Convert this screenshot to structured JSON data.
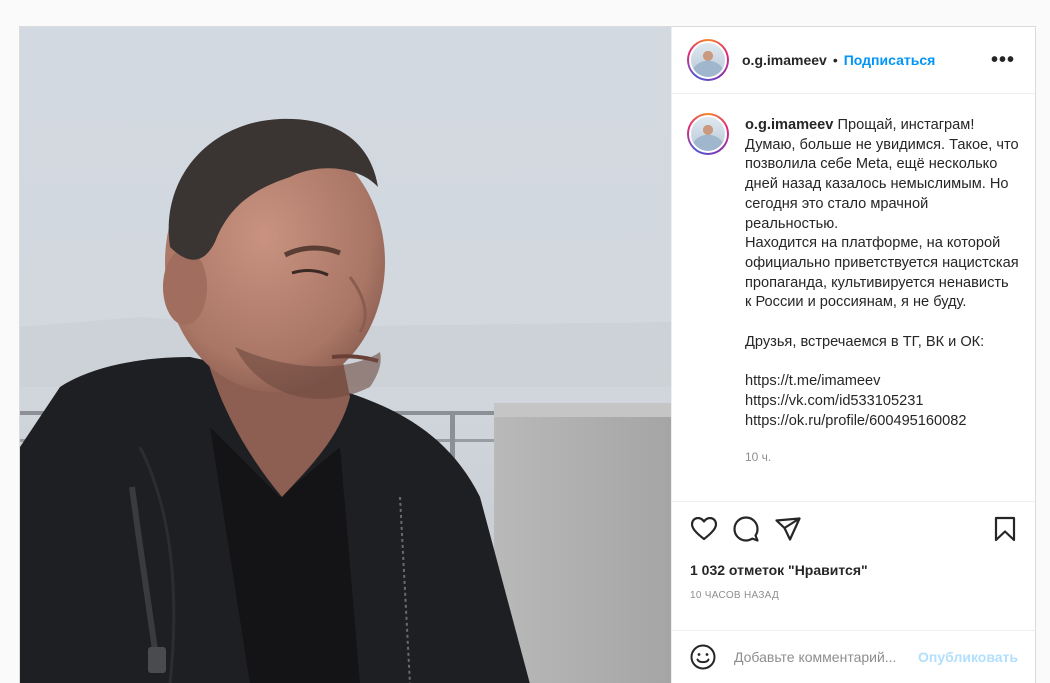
{
  "post": {
    "image_alt": "Man in black jacket looking into the distance by the waterfront",
    "author": {
      "username": "o.g.imameev"
    },
    "header": {
      "dot": "•",
      "follow_label": "Подписаться",
      "more_label": "•••"
    },
    "caption": {
      "username": "o.g.imameev",
      "text": "Прощай, инстаграм! Думаю, больше не увидимся. Такое, что позволила себе Meta, ещё несколько дней назад казалось немыслимым. Но сегодня это стало мрачной реальностью.\nНаходится на платформе, на которой официально приветствуется нацистская пропаганда, культивируется ненависть к России и россиянам, я не буду.\n\nДрузья, встречаемся в ТГ, ВК и ОК:\n\nhttps://t.me/imameev\nhttps://vk.com/id533105231\nhttps://ok.ru/profile/600495160082",
      "time": "10 ч."
    },
    "actions": {
      "like_icon": "heart-icon",
      "comment_icon": "comment-bubble-icon",
      "share_icon": "paper-plane-icon",
      "save_icon": "bookmark-icon"
    },
    "likes_text": "1 032 отметок \"Нравится\"",
    "posted_ago": "10 часов назад",
    "comment": {
      "placeholder": "Добавьте комментарий...",
      "post_label": "Опубликовать",
      "emoji_icon": "smiley-icon"
    }
  },
  "colors": {
    "accent": "#0095f6",
    "post_disabled": "#b2dffc",
    "muted": "#8e8e8e",
    "text": "#262626",
    "border": "#dbdbdb"
  }
}
